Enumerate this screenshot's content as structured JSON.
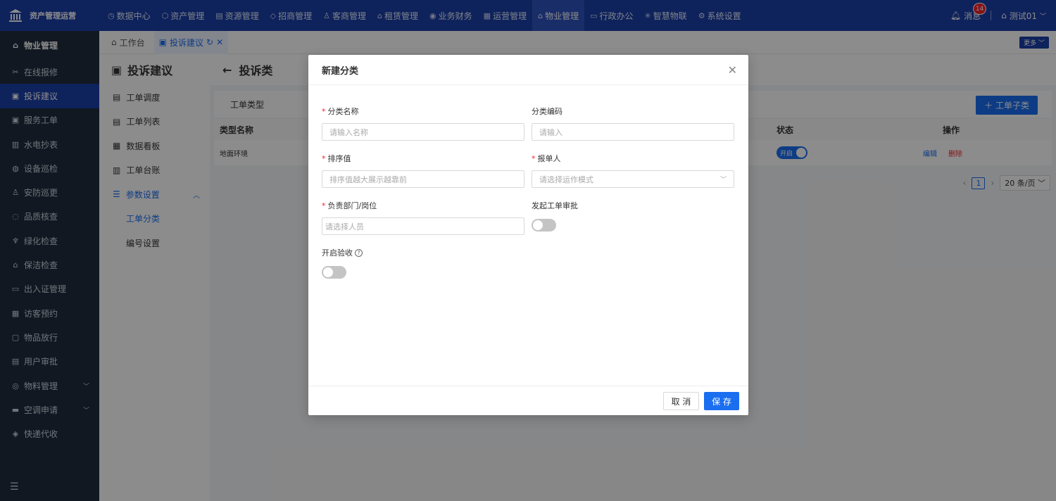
{
  "app": {
    "title": "资产管理运营"
  },
  "nav": {
    "items": [
      {
        "label": "数据中心",
        "icon": "clock"
      },
      {
        "label": "资产管理",
        "icon": "cube"
      },
      {
        "label": "资源管理",
        "icon": "building"
      },
      {
        "label": "招商管理",
        "icon": "tag"
      },
      {
        "label": "客商管理",
        "icon": "users"
      },
      {
        "label": "租赁管理",
        "icon": "house"
      },
      {
        "label": "业务财务",
        "icon": "coin"
      },
      {
        "label": "运营管理",
        "icon": "chart"
      },
      {
        "label": "物业管理",
        "icon": "home",
        "active": true
      },
      {
        "label": "行政办公",
        "icon": "monitor"
      },
      {
        "label": "智慧物联",
        "icon": "gear-spark"
      },
      {
        "label": "系统设置",
        "icon": "gear"
      }
    ],
    "messages_label": "消息",
    "messages_count": "14",
    "user_label": "测试01"
  },
  "sidebar": {
    "header": "物业管理",
    "items": [
      {
        "label": "在线报修"
      },
      {
        "label": "投诉建议",
        "active": true
      },
      {
        "label": "服务工单"
      },
      {
        "label": "水电抄表"
      },
      {
        "label": "设备巡检"
      },
      {
        "label": "安防巡更"
      },
      {
        "label": "品质核查"
      },
      {
        "label": "绿化检查"
      },
      {
        "label": "保洁检查"
      },
      {
        "label": "出入证管理"
      },
      {
        "label": "访客预约"
      },
      {
        "label": "物品放行"
      },
      {
        "label": "用户审批"
      },
      {
        "label": "物料管理",
        "expandable": true
      },
      {
        "label": "空调申请",
        "expandable": true
      },
      {
        "label": "快递代收"
      }
    ]
  },
  "tabs": {
    "workbench": "工作台",
    "current": "投诉建议",
    "more": "更多"
  },
  "subnav": {
    "title": "投诉建议",
    "items": [
      "工单调度",
      "工单列表",
      "数据看板",
      "工单台账"
    ],
    "params": "参数设置",
    "children": [
      "工单分类",
      "编号设置"
    ]
  },
  "content": {
    "title": "投诉类",
    "filter_label": "工单类型",
    "add_sub_button": "工单子类",
    "columns": {
      "name": "类型名称",
      "status": "状态",
      "ops": "操作"
    },
    "row": {
      "name": "地面环境",
      "status": "开启",
      "edit": "编辑",
      "delete": "删除"
    },
    "pager": {
      "page": "1",
      "size": "20 条/页"
    }
  },
  "modal": {
    "title": "新建分类",
    "name_label": "分类名称",
    "name_placeholder": "请输入名称",
    "code_label": "分类编码",
    "code_placeholder": "请输入",
    "sort_label": "排序值",
    "sort_placeholder": "排序值越大展示越靠前",
    "reporter_label": "报单人",
    "reporter_placeholder": "请选择运作模式",
    "dept_label": "负责部门/岗位",
    "dept_placeholder": "请选择人员",
    "approval_label": "发起工单审批",
    "acceptance_label": "开启验收",
    "cancel": "取 消",
    "save": "保 存"
  },
  "colors": {
    "brand": "#1a3ea8",
    "primary": "#1a6ef0",
    "danger": "#f5222d",
    "sidebar": "#1f2d3d"
  }
}
